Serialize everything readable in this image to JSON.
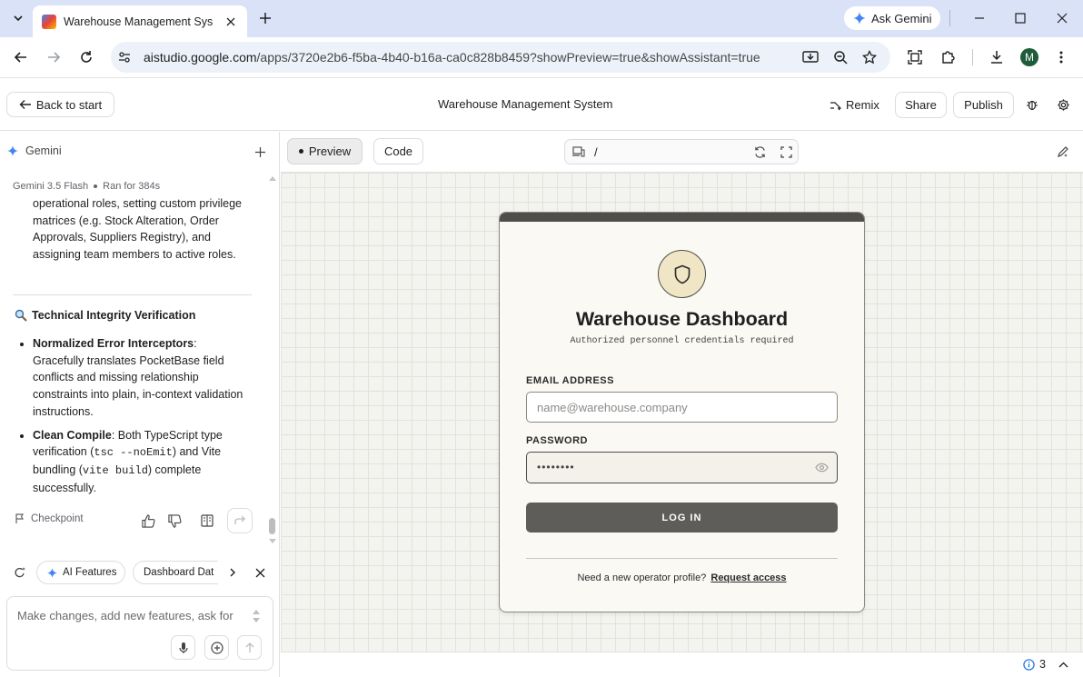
{
  "browser": {
    "tab_title": "Warehouse Management System",
    "ask_gemini": "Ask Gemini",
    "url_host": "aistudio.google.com",
    "url_path": "/apps/3720e2b6-f5ba-4b40-b16a-ca0c828b8459?showPreview=true&showAssistant=true",
    "profile_initial": "M"
  },
  "header": {
    "back_label": "Back to start",
    "title": "Warehouse Management System",
    "remix": "Remix",
    "share": "Share",
    "publish": "Publish"
  },
  "panel": {
    "name": "Gemini",
    "model": "Gemini 3.5 Flash",
    "ran_for": "Ran for 384s",
    "paragraph": "operational roles, setting custom privilege matrices (e.g. Stock Alteration, Order Approvals, Suppliers Registry), and assigning team members to active roles.",
    "section_heading": "Technical Integrity Verification",
    "bullets": [
      {
        "bold": "Normalized Error Interceptors",
        "text": ": Gracefully translates PocketBase field conflicts and missing relationship constraints into plain, in-context validation instructions."
      },
      {
        "bold": "Clean Compile",
        "text_a": ": Both TypeScript type verification (",
        "code_a": "tsc --noEmit",
        "text_b": ") and Vite bundling (",
        "code_b": "vite build",
        "text_c": ") complete successfully."
      }
    ],
    "checkpoint": "Checkpoint",
    "chips": [
      "AI Features",
      "Dashboard Dat"
    ],
    "input_placeholder": "Make changes, add new features, ask for"
  },
  "preview_bar": {
    "preview_tab": "Preview",
    "code_tab": "Code",
    "path": "/"
  },
  "login": {
    "title": "Warehouse Dashboard",
    "subtitle": "Authorized personnel credentials required",
    "email_label": "EMAIL ADDRESS",
    "email_placeholder": "name@warehouse.company",
    "password_label": "PASSWORD",
    "password_value": "••••••••",
    "login_button": "LOG IN",
    "footer_text": "Need a new operator profile?",
    "request_access": "Request access"
  },
  "status": {
    "issues_count": "3"
  }
}
